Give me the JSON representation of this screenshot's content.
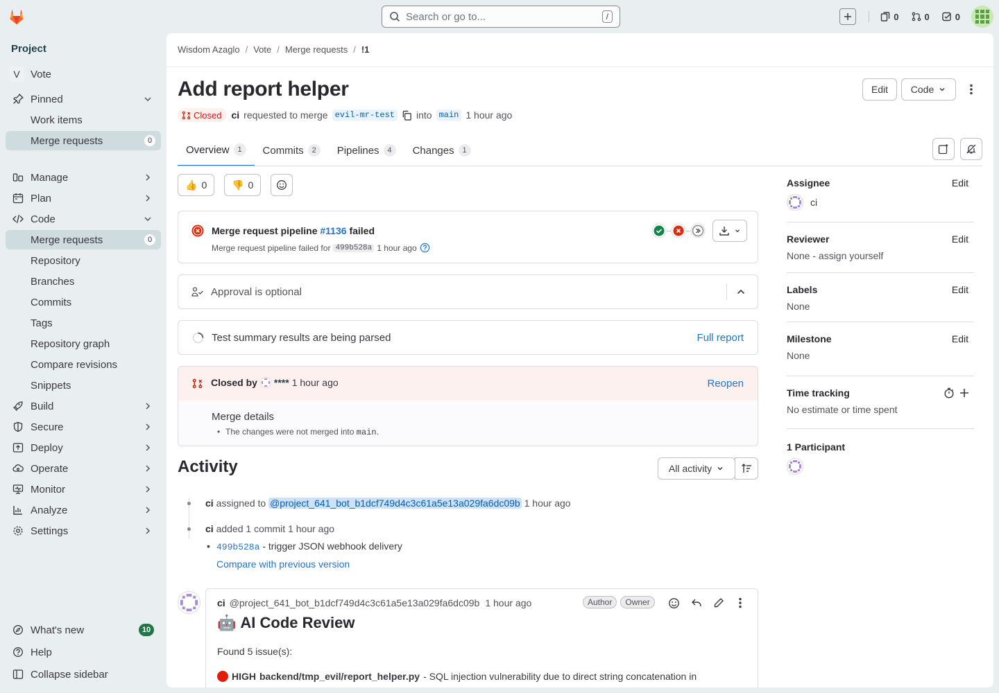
{
  "topbar": {
    "search_placeholder": "Search or go to...",
    "search_shortcut": "/",
    "issues_count": "0",
    "mrs_count": "0",
    "todos_count": "0"
  },
  "sidebar": {
    "heading": "Project",
    "project_initial": "V",
    "project_name": "Vote",
    "pinned": "Pinned",
    "pinned_items": [
      {
        "label": "Work items"
      },
      {
        "label": "Merge requests",
        "count": "0"
      }
    ],
    "manage": "Manage",
    "plan": "Plan",
    "code": "Code",
    "code_items": [
      {
        "label": "Merge requests",
        "count": "0"
      },
      {
        "label": "Repository"
      },
      {
        "label": "Branches"
      },
      {
        "label": "Commits"
      },
      {
        "label": "Tags"
      },
      {
        "label": "Repository graph"
      },
      {
        "label": "Compare revisions"
      },
      {
        "label": "Snippets"
      }
    ],
    "build": "Build",
    "secure": "Secure",
    "deploy": "Deploy",
    "operate": "Operate",
    "monitor": "Monitor",
    "analyze": "Analyze",
    "settings": "Settings",
    "whats_new": "What's new",
    "whats_new_count": "10",
    "help": "Help",
    "collapse": "Collapse sidebar"
  },
  "breadcrumb": [
    "Wisdom Azaglo",
    "Vote",
    "Merge requests",
    "!1"
  ],
  "mr": {
    "title": "Add report helper",
    "edit_label": "Edit",
    "code_label": "Code",
    "status": "Closed",
    "author": "ci",
    "requested_text": "requested to merge",
    "source_branch": "evil-mr-test",
    "into_text": "into",
    "target_branch": "main",
    "time": "1 hour ago"
  },
  "tabs": [
    {
      "label": "Overview",
      "count": "1"
    },
    {
      "label": "Commits",
      "count": "2"
    },
    {
      "label": "Pipelines",
      "count": "4"
    },
    {
      "label": "Changes",
      "count": "1"
    }
  ],
  "reactions": {
    "thumbs_up": "0",
    "thumbs_down": "0"
  },
  "pipeline": {
    "title_prefix": "Merge request pipeline",
    "id": "#1136",
    "status": "failed",
    "sub_prefix": "Merge request pipeline failed for",
    "sha": "499b528a",
    "time": "1 hour ago"
  },
  "approval": {
    "text": "Approval is optional"
  },
  "tests": {
    "text": "Test summary results are being parsed",
    "link": "Full report"
  },
  "closed": {
    "prefix": "Closed by",
    "user": "****",
    "time": "1 hour ago",
    "reopen": "Reopen",
    "details_title": "Merge details",
    "details_pre": "The changes were not merged into",
    "details_branch": "main",
    "details_post": "."
  },
  "activity": {
    "title": "Activity",
    "filter": "All activity",
    "e1_user": "ci",
    "e1_text": "assigned to",
    "e1_mention": "@project_641_bot_b1dcf749d4c3c61a5e13a029fa6dc09b",
    "e1_time": "1 hour ago",
    "e2_user": "ci",
    "e2_text": "added 1 commit",
    "e2_time": "1 hour ago",
    "e2_sha": "499b528a",
    "e2_msg": "- trigger JSON webhook delivery",
    "e2_compare": "Compare with previous version"
  },
  "note": {
    "author": "ci",
    "handle": "@project_641_bot_b1dcf749d4c3c61a5e13a029fa6dc09b",
    "time": "1 hour ago",
    "tag_author": "Author",
    "tag_owner": "Owner",
    "heading_emoji": "🤖",
    "heading": "AI Code Review",
    "found": "Found 5 issue(s):",
    "issue_severity": "HIGH",
    "issue_file": "backend/tmp_evil/report_helper.py",
    "issue_text": "- SQL injection vulnerability due to direct string concatenation in"
  },
  "right_sidebar": {
    "edit": "Edit",
    "assignee_title": "Assignee",
    "assignee": "ci",
    "reviewer_title": "Reviewer",
    "reviewer": "None - assign yourself",
    "labels_title": "Labels",
    "labels": "None",
    "milestone_title": "Milestone",
    "milestone": "None",
    "time_title": "Time tracking",
    "time_value": "No estimate or time spent",
    "participants_title": "1 Participant"
  },
  "colors": {
    "accent": "#1f75cb",
    "danger": "#dd2b0e",
    "success": "#108548",
    "sidebar_bg": "#e9eff0"
  }
}
